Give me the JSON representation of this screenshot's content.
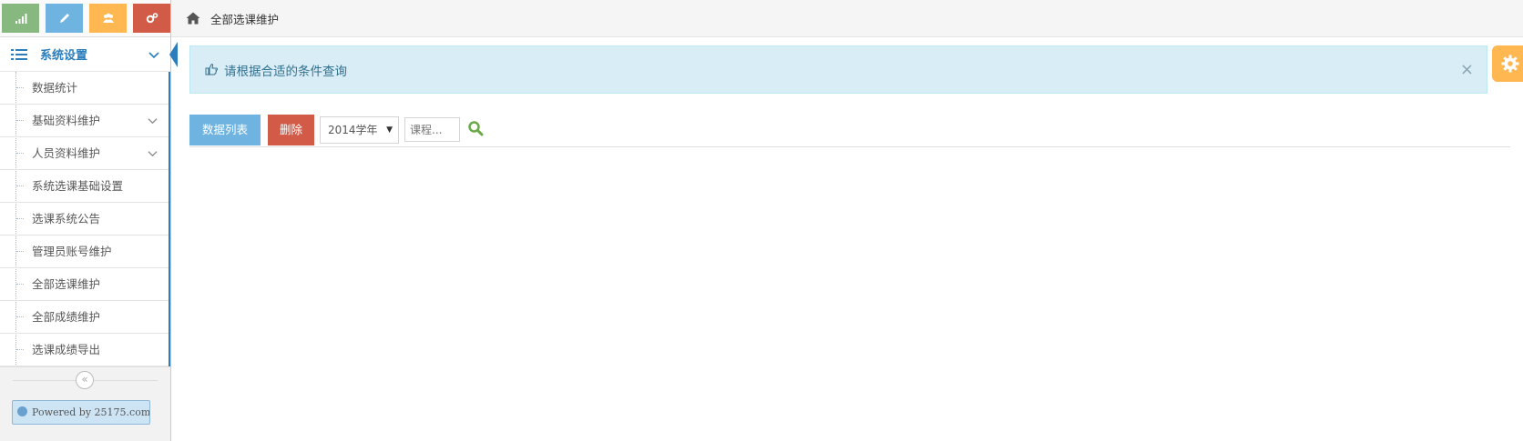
{
  "breadcrumb": {
    "current": "全部选课维护"
  },
  "sidebar": {
    "shortcuts": [
      {
        "icon": "signal-icon",
        "color": "#87b87f"
      },
      {
        "icon": "pencil-icon",
        "color": "#6fb3e0"
      },
      {
        "icon": "group-icon",
        "color": "#ffb752"
      },
      {
        "icon": "cogs-icon",
        "color": "#d15b47"
      }
    ],
    "menu_title": "系统设置",
    "items": [
      {
        "label": "数据统计",
        "has_children": false
      },
      {
        "label": "基础资料维护",
        "has_children": true
      },
      {
        "label": "人员资料维护",
        "has_children": true
      },
      {
        "label": "系统选课基础设置",
        "has_children": false
      },
      {
        "label": "选课系统公告",
        "has_children": false
      },
      {
        "label": "管理员账号维护",
        "has_children": false
      },
      {
        "label": "全部选课维护",
        "has_children": false
      },
      {
        "label": "全部成绩维护",
        "has_children": false
      },
      {
        "label": "选课成绩导出",
        "has_children": false
      }
    ],
    "collapse_glyph": "«",
    "powered_by": "Powered by 25175.com"
  },
  "alert": {
    "message": "请根据合适的条件查询",
    "close": "×"
  },
  "toolbar": {
    "list_button": "数据列表",
    "delete_button": "删除",
    "year_select": "2014学年",
    "course_placeholder": "课程..."
  },
  "colors": {
    "accent": "#2b7dbc",
    "alert_bg": "#d9edf7",
    "settings_bg": "#ffb752"
  }
}
